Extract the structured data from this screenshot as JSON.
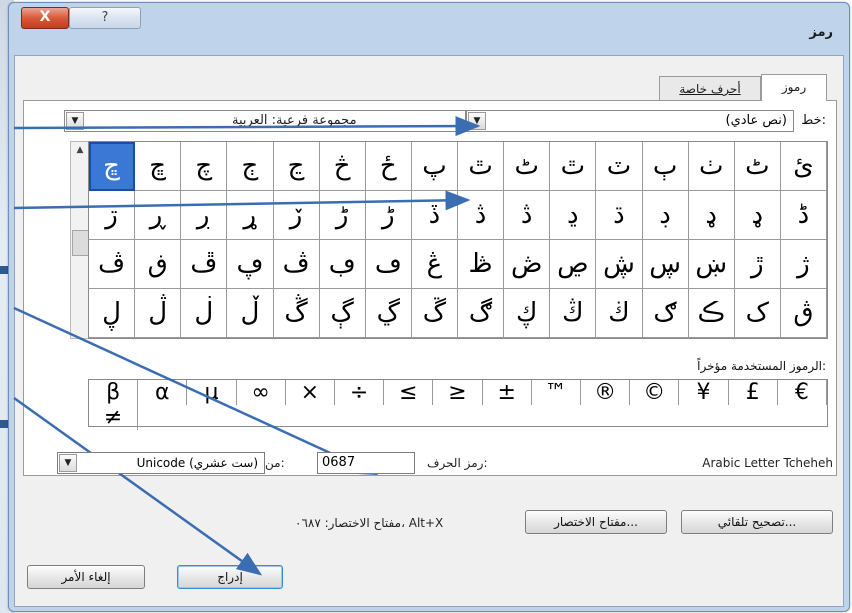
{
  "window": {
    "title": "رمز",
    "close_label": "X",
    "help_label": "?"
  },
  "tabs": [
    {
      "label": "رموز"
    },
    {
      "label": "أحرف خاصة"
    }
  ],
  "font": {
    "label": "خط:",
    "value": "(نص عادي)"
  },
  "subset": {
    "label": "مجموعة فرعية:",
    "value": "العربية"
  },
  "grid": {
    "rows": [
      [
        "ئ",
        "ٹ",
        "ٺ",
        "ٻ",
        "ٽ",
        "ٿ",
        "ٹ",
        "ٿ",
        "پ",
        "ځ",
        "څ",
        "ڃ",
        "ڄ",
        "چ",
        "ڇ",
        "ڇ"
      ],
      [
        "ڈ",
        "ډ",
        "ډ",
        "ڊ",
        "ڌ",
        "ڍ",
        "ڎ",
        "ڎ",
        "ڏ",
        "ڑ",
        "ڑ",
        "ڒ",
        "ړ",
        "ڔ",
        "ڕ",
        "ڗ"
      ],
      [
        "ژ",
        "ڙ",
        "ښ",
        "ڛ",
        "ڜ",
        "ڝ",
        "ڞ",
        "ڟ",
        "ڠ",
        "ڡ",
        "ڢ",
        "ڤ",
        "ڥ",
        "ڦ",
        "ڧ",
        "ڤ"
      ],
      [
        "ڨ",
        "ک",
        "ڪ",
        "ګ",
        "ڬ",
        "ڭ",
        "ڮ",
        "ڰ",
        "ڱ",
        "ڲ",
        "ڳ",
        "ڴ",
        "ڵ",
        "ڶ",
        "ڷ",
        "ڸ"
      ]
    ],
    "selected_glyph": "ڇ"
  },
  "recent": {
    "label": "الرموز المستخدمة مؤخراً:",
    "symbols": [
      "≠",
      "€",
      "£",
      "¥",
      "©",
      "®",
      "™",
      "±",
      "≥",
      "≤",
      "÷",
      "×",
      "∞",
      "µ",
      "α",
      "β"
    ]
  },
  "character": {
    "name": "Arabic Letter Tcheheh",
    "code_label": "رمز الحرف:",
    "code_value": "0687",
    "from_label": "من:",
    "from_value": "Unicode (ست عشري)"
  },
  "buttons": {
    "autocorrect": "تصحيح تلقائي...",
    "shortcut_key": "مفتاح الاختصار...",
    "shortcut_text": "مفتاح الاختصار: ٠٦٨٧، Alt+X",
    "insert": "إدراج",
    "cancel": "إلغاء الأمر"
  },
  "colors": {
    "accent": "#3a78d6",
    "arrow": "#3b6db3"
  }
}
